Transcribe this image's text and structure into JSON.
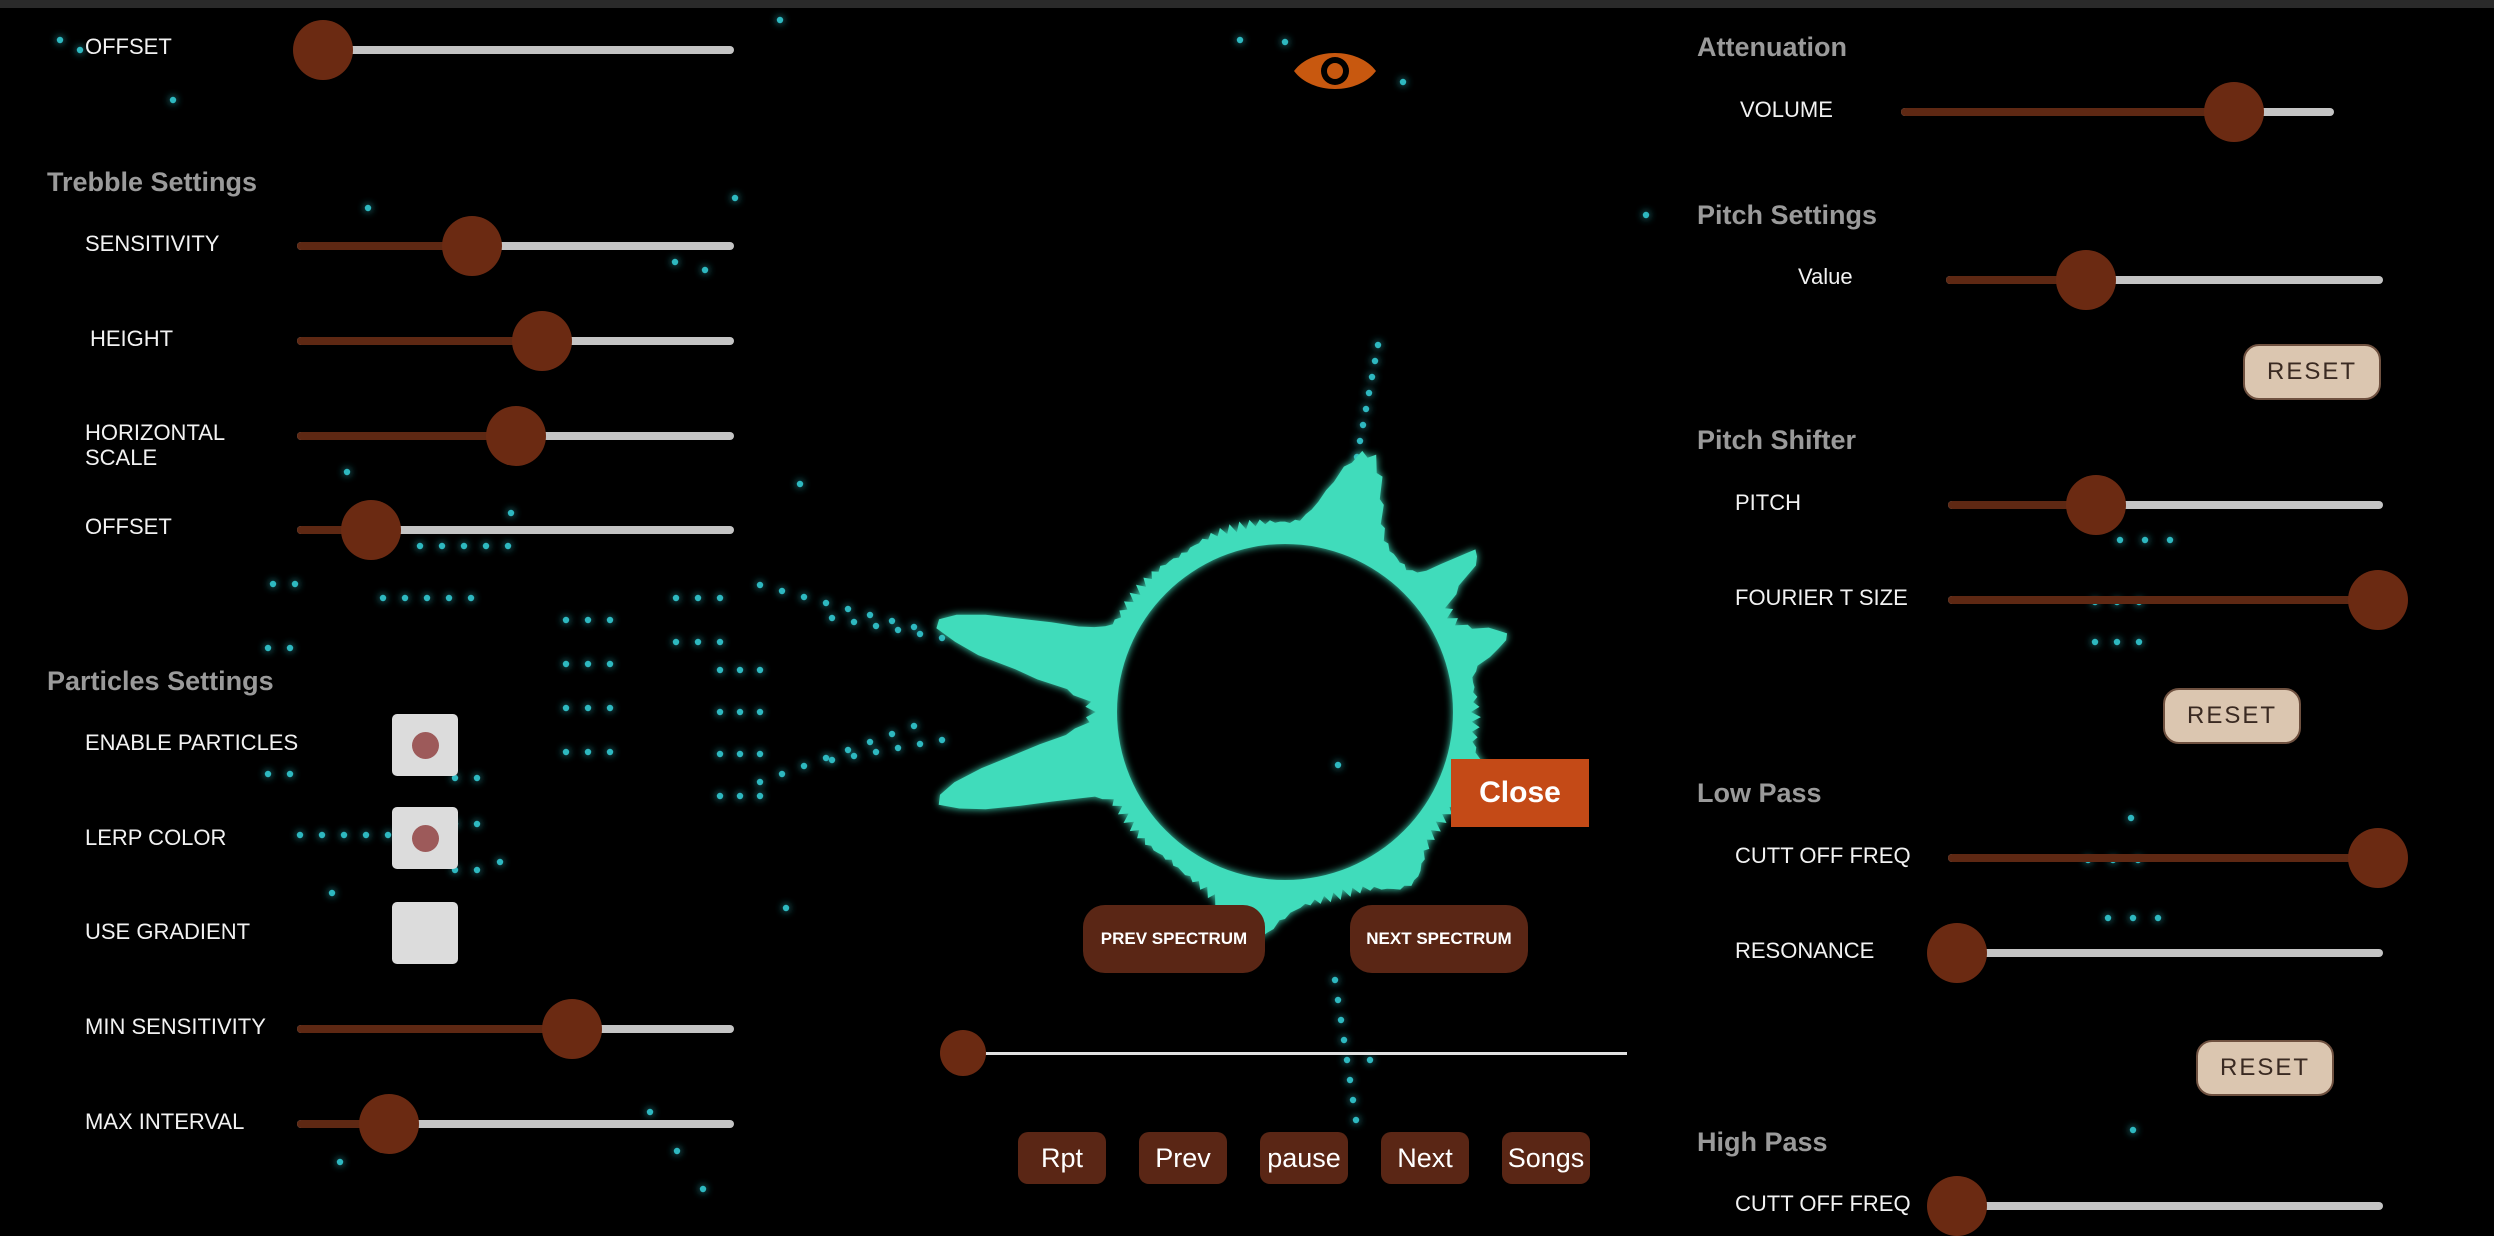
{
  "colors": {
    "background": "#000000",
    "particle": "#2fb8c0",
    "spectrum": "#3fdcbb",
    "slider_fill": "#5e2813",
    "slider_knob": "#6b2a12",
    "slider_rail": "#c4c4c4",
    "close_button": "#c44a17",
    "reset_button": "#dbc6b0",
    "eye_icon": "#c8580f"
  },
  "left_panel": {
    "bass_offset": {
      "label": "OFFSET",
      "value": 0.06
    },
    "trebble": {
      "title": "Trebble Settings",
      "sensitivity": {
        "label": "SENSITIVITY",
        "value": 0.4
      },
      "height": {
        "label": "HEIGHT",
        "value": 0.56
      },
      "horizontal_scale": {
        "label_line1": "HORIZONTAL",
        "label_line2": "SCALE",
        "value": 0.5
      },
      "offset": {
        "label": "OFFSET",
        "value": 0.17
      }
    },
    "particles": {
      "title": "Particles Settings",
      "enable_particles": {
        "label": "ENABLE PARTICLES",
        "checked": true
      },
      "lerp_color": {
        "label": "LERP COLOR",
        "checked": true
      },
      "use_gradient": {
        "label": "USE GRADIENT",
        "checked": false
      },
      "min_sensitivity": {
        "label": "MIN SENSITIVITY",
        "value": 0.63
      },
      "max_interval": {
        "label": "MAX INTERVAL",
        "value": 0.21
      }
    }
  },
  "center": {
    "eye_icon": "eye-icon",
    "close_label": "Close",
    "prev_spectrum_label": "PREV SPECTRUM",
    "next_spectrum_label": "NEXT SPECTRUM",
    "seek_value": 0.0,
    "controls": {
      "repeat_label": "Rpt",
      "prev_label": "Prev",
      "pause_label": "pause",
      "next_label": "Next",
      "songs_label": "Songs"
    }
  },
  "right_panel": {
    "attenuation": {
      "title": "Attenuation",
      "volume": {
        "label": "VOLUME",
        "value": 0.77
      }
    },
    "pitch_settings": {
      "title": "Pitch Settings",
      "value_slider": {
        "label": "Value",
        "value": 0.32
      },
      "reset_label": "RESET"
    },
    "pitch_shifter": {
      "title": "Pitch Shifter",
      "pitch": {
        "label": "PITCH",
        "value": 0.34
      },
      "fourier_size": {
        "label": "FOURIER T SIZE",
        "value": 1.0
      },
      "reset_label": "RESET"
    },
    "low_pass": {
      "title": "Low Pass",
      "cutoff": {
        "label": "CUTT OFF FREQ",
        "value": 1.0
      },
      "resonance": {
        "label": "RESONANCE",
        "value": 0.02
      },
      "reset_label": "RESET"
    },
    "high_pass": {
      "title": "High Pass",
      "cutoff": {
        "label": "CUTT OFF FREQ",
        "value": 0.02
      }
    }
  }
}
